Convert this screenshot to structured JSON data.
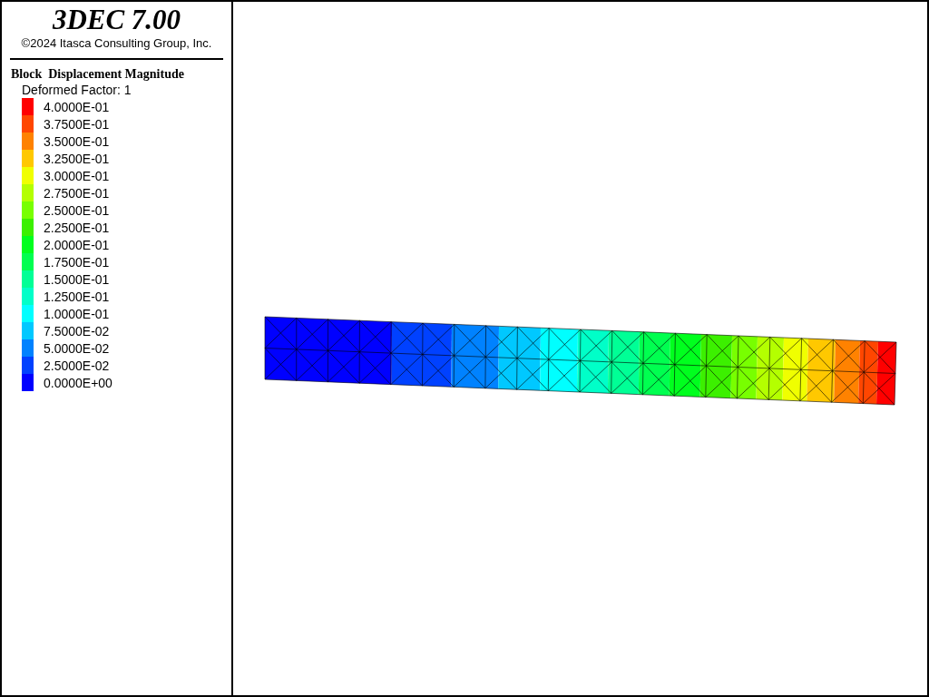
{
  "title": "3DEC 7.00",
  "copyright": "©2024 Itasca Consulting Group, Inc.",
  "legend": {
    "title": "Block  Displacement Magnitude",
    "subtitle": "Deformed Factor: 1",
    "items": [
      {
        "label": "4.0000E-01",
        "color": "#ff0000"
      },
      {
        "label": "3.7500E-01",
        "color": "#ff4600"
      },
      {
        "label": "3.5000E-01",
        "color": "#ff8200"
      },
      {
        "label": "3.2500E-01",
        "color": "#ffc800"
      },
      {
        "label": "3.0000E-01",
        "color": "#f0ff00"
      },
      {
        "label": "2.7500E-01",
        "color": "#b4ff00"
      },
      {
        "label": "2.5000E-01",
        "color": "#78ff00"
      },
      {
        "label": "2.2500E-01",
        "color": "#3cf000"
      },
      {
        "label": "2.0000E-01",
        "color": "#00ff1e"
      },
      {
        "label": "1.7500E-01",
        "color": "#00ff50"
      },
      {
        "label": "1.5000E-01",
        "color": "#00ff96"
      },
      {
        "label": "1.2500E-01",
        "color": "#00ffc8"
      },
      {
        "label": "1.0000E-01",
        "color": "#00ffff"
      },
      {
        "label": "7.5000E-02",
        "color": "#00c8ff"
      },
      {
        "label": "5.0000E-02",
        "color": "#0082ff"
      },
      {
        "label": "2.5000E-02",
        "color": "#0041ff"
      },
      {
        "label": "0.0000E+00",
        "color": "#0000ff"
      }
    ]
  }
}
